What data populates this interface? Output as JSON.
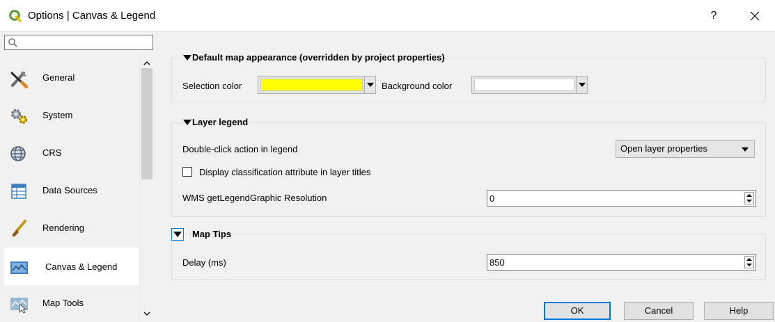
{
  "window": {
    "title": "Options | Canvas & Legend",
    "help_glyph": "?",
    "close_glyph": "✕"
  },
  "search": {
    "value": "",
    "placeholder": ""
  },
  "sidebar": {
    "items": [
      {
        "label": "General",
        "icon": "tools-icon"
      },
      {
        "label": "System",
        "icon": "system-gears-icon"
      },
      {
        "label": "CRS",
        "icon": "globe-icon"
      },
      {
        "label": "Data Sources",
        "icon": "table-icon"
      },
      {
        "label": "Rendering",
        "icon": "paintbrush-icon"
      },
      {
        "label": "Canvas & Legend",
        "icon": "map-canvas-icon",
        "selected": true
      },
      {
        "label": "Map Tools",
        "icon": "map-tools-icon"
      }
    ]
  },
  "default_map": {
    "title": "Default map appearance (overridden by project properties)",
    "selection_color_label": "Selection color",
    "selection_color": "#ffff00",
    "background_color_label": "Background color",
    "background_color": "#ffffff"
  },
  "layer_legend": {
    "title": "Layer legend",
    "double_click_label": "Double-click action in legend",
    "double_click_value": "Open layer properties",
    "display_classification_label": "Display classification attribute in layer titles",
    "display_classification_checked": false,
    "wms_resolution_label": "WMS getLegendGraphic Resolution",
    "wms_resolution_value": "0"
  },
  "map_tips": {
    "title": "Map Tips",
    "delay_label": "Delay (ms)",
    "delay_value": "850"
  },
  "buttons": {
    "ok": "OK",
    "cancel": "Cancel",
    "help": "Help"
  },
  "colors": {
    "accent": "#0078d7",
    "qgis_green": "#589632",
    "qgis_yellow": "#eebb00"
  }
}
